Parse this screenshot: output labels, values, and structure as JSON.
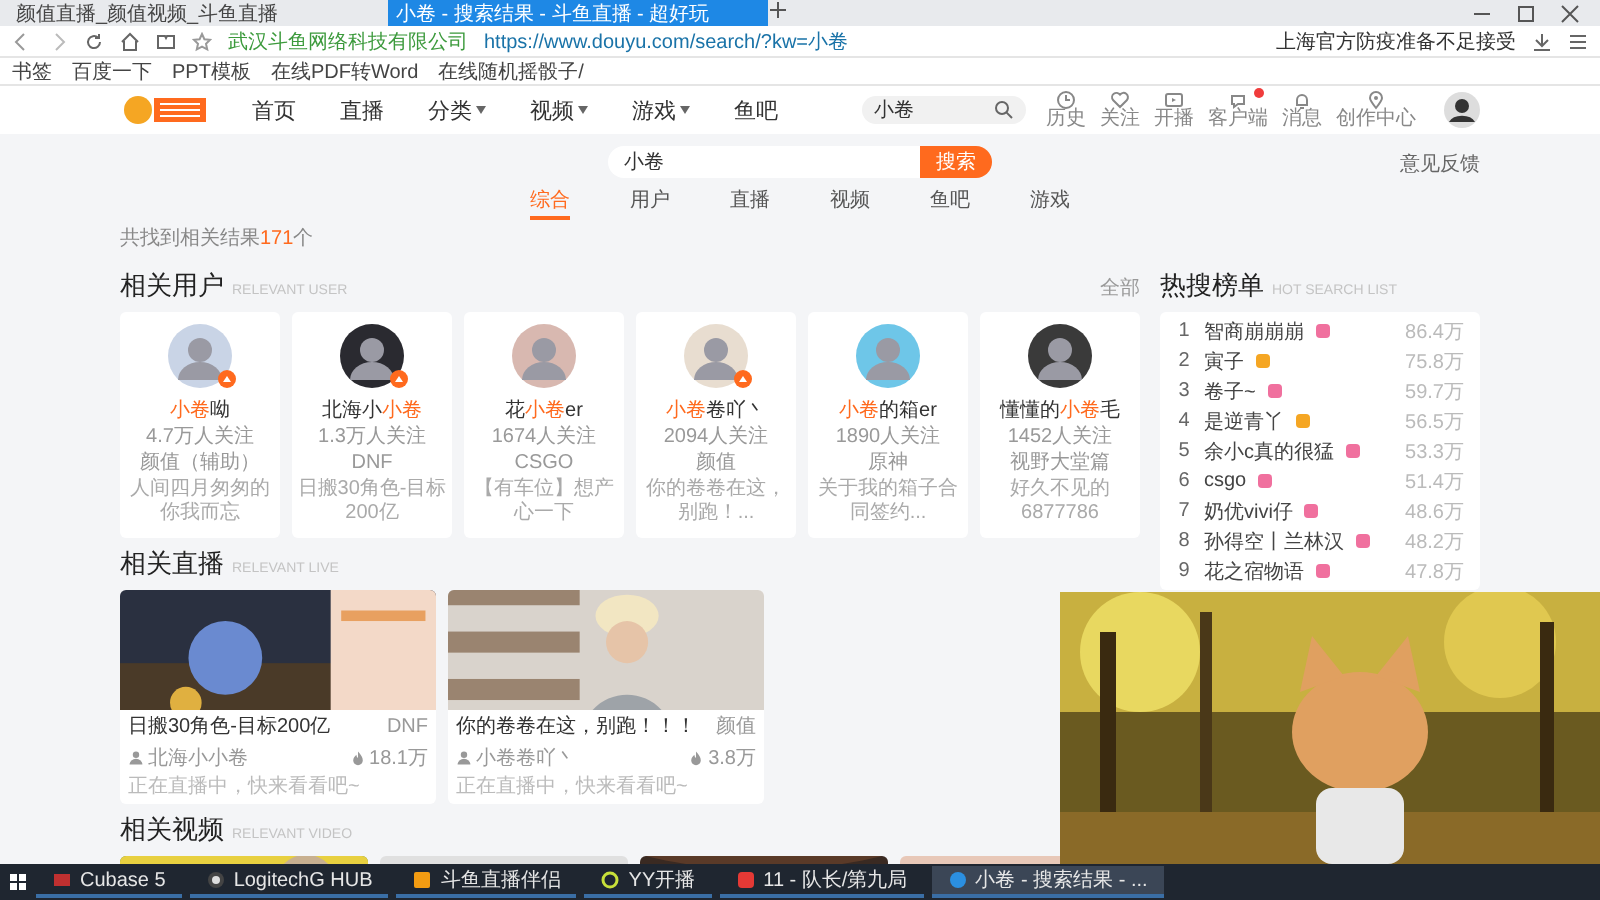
{
  "browser": {
    "tabs": [
      {
        "label": "颜值直播_颜值视频_斗鱼直播",
        "selected": false
      },
      {
        "label": "小卷 - 搜索结果 - 斗鱼直播 - 超好玩",
        "selected": true
      }
    ],
    "site_name": "武汉斗鱼网络科技有限公司",
    "url": "https://www.douyu.com/search/?kw=小卷",
    "news": "上海官方防疫准备不足接受",
    "bookmarks": [
      "书签",
      "百度一下",
      "PPT模板",
      "在线PDF转Word",
      "在线随机摇骰子/"
    ]
  },
  "header": {
    "nav": [
      {
        "label": "首页",
        "dropdown": false
      },
      {
        "label": "直播",
        "dropdown": false
      },
      {
        "label": "分类",
        "dropdown": true
      },
      {
        "label": "视频",
        "dropdown": true
      },
      {
        "label": "游戏",
        "dropdown": true
      },
      {
        "label": "鱼吧",
        "dropdown": false
      }
    ],
    "search": {
      "value": "小卷"
    },
    "actions": [
      "历史",
      "关注",
      "开播",
      "客户端",
      "消息",
      "创作中心"
    ]
  },
  "search": {
    "value": "小卷",
    "button": "搜索",
    "feedback": "意见反馈",
    "tabs": [
      {
        "label": "综合",
        "selected": true
      },
      {
        "label": "用户",
        "selected": false
      },
      {
        "label": "直播",
        "selected": false
      },
      {
        "label": "视频",
        "selected": false
      },
      {
        "label": "鱼吧",
        "selected": false
      },
      {
        "label": "游戏",
        "selected": false
      }
    ],
    "result_count": {
      "prefix": "共找到相关结果",
      "count": "171",
      "suffix": "个"
    }
  },
  "users": {
    "title": "相关用户",
    "subtitle": "RELEVANT USER",
    "more": "全部",
    "items": [
      {
        "name": [
          {
            "text": "小卷",
            "hit": true
          },
          {
            "text": "呦",
            "hit": false
          }
        ],
        "followers": "4.7万人关注",
        "category": "颜值（辅助）",
        "desc": "人间四月匆匆的你我而忘",
        "live": true
      },
      {
        "name": [
          {
            "text": "北海小",
            "hit": false
          },
          {
            "text": "小卷",
            "hit": true
          }
        ],
        "followers": "1.3万人关注",
        "category": "DNF",
        "desc": "日搬30角色-目标200亿",
        "live": true
      },
      {
        "name": [
          {
            "text": "花",
            "hit": false
          },
          {
            "text": "小卷",
            "hit": true
          },
          {
            "text": "er",
            "hit": false
          }
        ],
        "followers": "1674人关注",
        "category": "CSGO",
        "desc": "【有车位】想产心一下",
        "live": false
      },
      {
        "name": [
          {
            "text": "小卷",
            "hit": true
          },
          {
            "text": "卷吖丶",
            "hit": false
          }
        ],
        "followers": "2094人关注",
        "category": "颜值",
        "desc": "你的卷卷在这，别跑！...",
        "live": true
      },
      {
        "name": [
          {
            "text": "小卷",
            "hit": true
          },
          {
            "text": "的箱er",
            "hit": false
          }
        ],
        "followers": "1890人关注",
        "category": "原神",
        "desc": "关于我的箱子合同签约...",
        "live": false
      },
      {
        "name": [
          {
            "text": "懂懂的",
            "hit": false
          },
          {
            "text": "小卷",
            "hit": true
          },
          {
            "text": "毛",
            "hit": false
          }
        ],
        "followers": "1452人关注",
        "category": "视野大堂篇",
        "desc": "好久不见的 6877786",
        "live": false
      }
    ]
  },
  "live": {
    "title": "相关直播",
    "subtitle": "RELEVANT LIVE",
    "items": [
      {
        "title": "日搬30角色-目标200亿",
        "category": "DNF",
        "streamer": "北海小小卷",
        "heat": "18.1万",
        "tag": "正在直播中，快来看看吧~"
      },
      {
        "title": "你的卷卷在这，别跑！！！",
        "category": "颜值",
        "streamer": "小卷卷吖丶",
        "heat": "3.8万",
        "tag": "正在直播中，快来看看吧~"
      }
    ]
  },
  "videos": {
    "title": "相关视频",
    "subtitle": "RELEVANT VIDEO"
  },
  "hot": {
    "title": "热搜榜单",
    "subtitle": "HOT SEARCH LIST",
    "items": [
      {
        "rank": "1",
        "name": "智商崩崩崩",
        "count": "86.4万",
        "color": "#f0709e"
      },
      {
        "rank": "2",
        "name": "寅子",
        "count": "75.8万",
        "color": "#f5a623"
      },
      {
        "rank": "3",
        "name": "卷子~",
        "count": "59.7万",
        "color": "#f0709e"
      },
      {
        "rank": "4",
        "name": "是逆青丫",
        "count": "56.5万",
        "color": "#f5a623"
      },
      {
        "rank": "5",
        "name": "余小c真的很猛",
        "count": "53.3万",
        "color": "#f0709e"
      },
      {
        "rank": "6",
        "name": "csgo",
        "count": "51.4万",
        "color": "#f0709e"
      },
      {
        "rank": "7",
        "name": "奶优vivi仔",
        "count": "48.6万",
        "color": "#f0709e"
      },
      {
        "rank": "8",
        "name": "孙得空丨兰林汉",
        "count": "48.2万",
        "color": "#f0709e"
      },
      {
        "rank": "9",
        "name": "花之宿物语",
        "count": "47.8万",
        "color": "#f0709e"
      }
    ]
  },
  "taskbar": {
    "items": [
      {
        "label": "Cubase 5",
        "selected": false
      },
      {
        "label": "LogitechG HUB",
        "selected": false
      },
      {
        "label": "斗鱼直播伴侣",
        "selected": false
      },
      {
        "label": "YY开播",
        "selected": false
      },
      {
        "label": "11 - 队长/第九局",
        "selected": false
      },
      {
        "label": "小卷 - 搜索结果 - ...",
        "selected": true
      }
    ]
  }
}
